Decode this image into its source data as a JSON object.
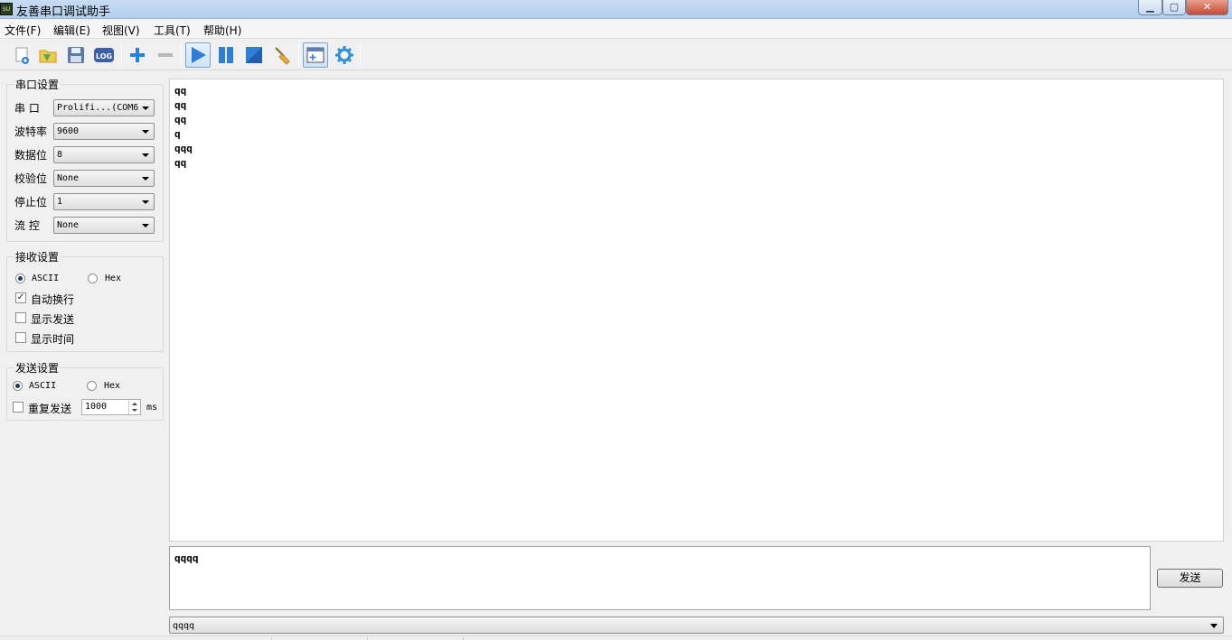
{
  "window": {
    "title": "友善串口调试助手",
    "app_icon_text": "SU",
    "minimize_glyph": "▁",
    "maximize_glyph": "▢",
    "close_glyph": "✕"
  },
  "menu": [
    "文件(F)",
    "编辑(E)",
    "视图(V)",
    "工具(T)",
    "帮助(H)"
  ],
  "toolbar": {
    "icons": [
      "new-session-icon",
      "open-folder-icon",
      "save-icon",
      "log-icon",
      "add-icon",
      "remove-icon",
      "play-icon",
      "pause-icon",
      "stop-icon",
      "broom-clear-icon",
      "layout-add-icon",
      "gear-icon"
    ],
    "log_text": "LOG"
  },
  "serial_settings": {
    "title": "串口设置",
    "fields": [
      {
        "label": "串  口",
        "value": "Prolifi...(COM6"
      },
      {
        "label": "波特率",
        "value": "9600"
      },
      {
        "label": "数据位",
        "value": "8"
      },
      {
        "label": "校验位",
        "value": "None"
      },
      {
        "label": "停止位",
        "value": "1"
      },
      {
        "label": "流  控",
        "value": "None"
      }
    ]
  },
  "receive_settings": {
    "title": "接收设置",
    "ascii_label": "ASCII",
    "hex_label": "Hex",
    "selected": "ASCII",
    "auto_newline_label": "自动换行",
    "auto_newline_checked": true,
    "show_send_label": "显示发送",
    "show_send_checked": false,
    "show_time_label": "显示时间",
    "show_time_checked": false
  },
  "send_settings": {
    "title": "发送设置",
    "ascii_label": "ASCII",
    "hex_label": "Hex",
    "selected": "ASCII",
    "repeat_label": "重复发送",
    "repeat_checked": false,
    "interval_value": "1000",
    "interval_unit": "ms"
  },
  "receive_lines": [
    "qq",
    "qq",
    "qq",
    "q",
    "qqq",
    "qq"
  ],
  "send_text": "qqqq",
  "send_button_label": "发送",
  "history_value": "qqqq",
  "colors": {
    "play_blue": "#2f7fd8",
    "title_bar": "#c6dcf3",
    "close_red": "#c74a33"
  }
}
